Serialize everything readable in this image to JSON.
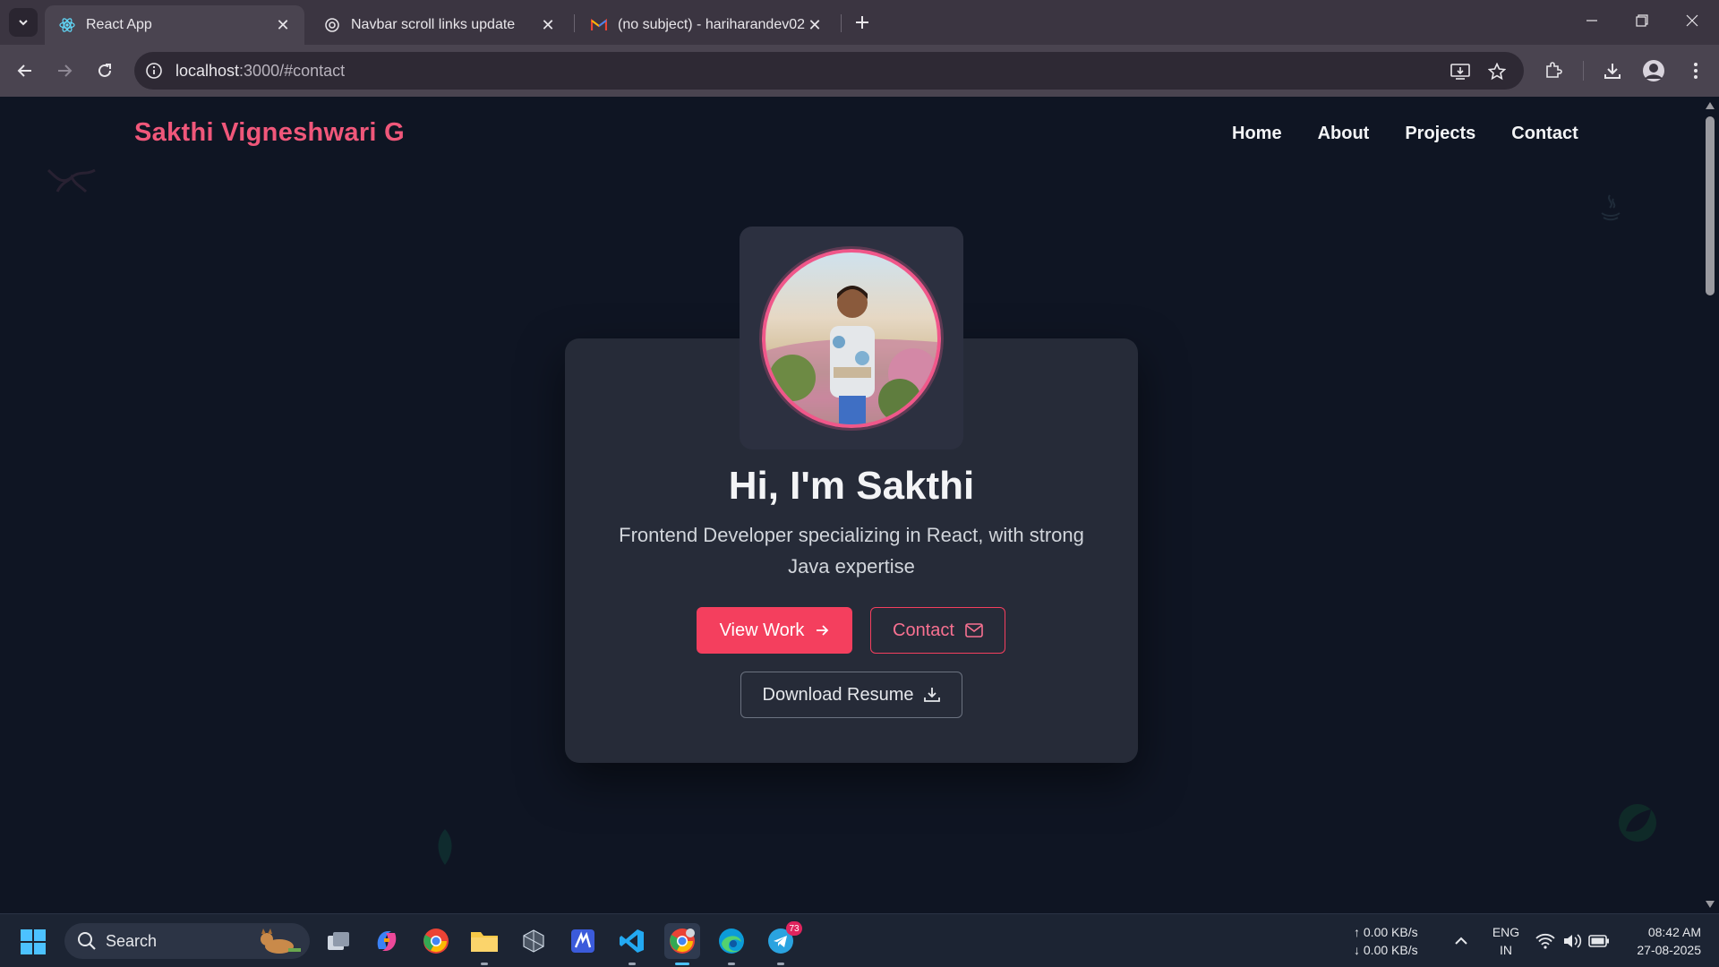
{
  "browser": {
    "tabs": [
      {
        "title": "React App",
        "active": true,
        "favicon": "react-icon"
      },
      {
        "title": "Navbar scroll links update",
        "active": false,
        "favicon": "chatgpt-icon"
      },
      {
        "title": "(no subject) - hariharandev02@",
        "active": false,
        "favicon": "gmail-icon"
      }
    ],
    "url_host": "localhost",
    "url_path": ":3000/#contact"
  },
  "page": {
    "brand": "Sakthi Vigneshwari G",
    "nav": [
      "Home",
      "About",
      "Projects",
      "Contact"
    ],
    "hero": {
      "title": "Hi, I'm Sakthi",
      "subtitle": "Frontend Developer specializing in React, with strong Java expertise",
      "primary_button": "View Work",
      "secondary_button": "Contact",
      "resume_button": "Download Resume"
    },
    "colors": {
      "accent": "#f43f5e",
      "background": "#0f1523",
      "card": "#262b38"
    }
  },
  "taskbar": {
    "search_label": "Search",
    "telegram_badge": "73",
    "net_up": "↑ 0.00 KB/s",
    "net_down": "↓ 0.00 KB/s",
    "lang_line1": "ENG",
    "lang_line2": "IN",
    "time": "08:42 AM",
    "date": "27-08-2025"
  }
}
